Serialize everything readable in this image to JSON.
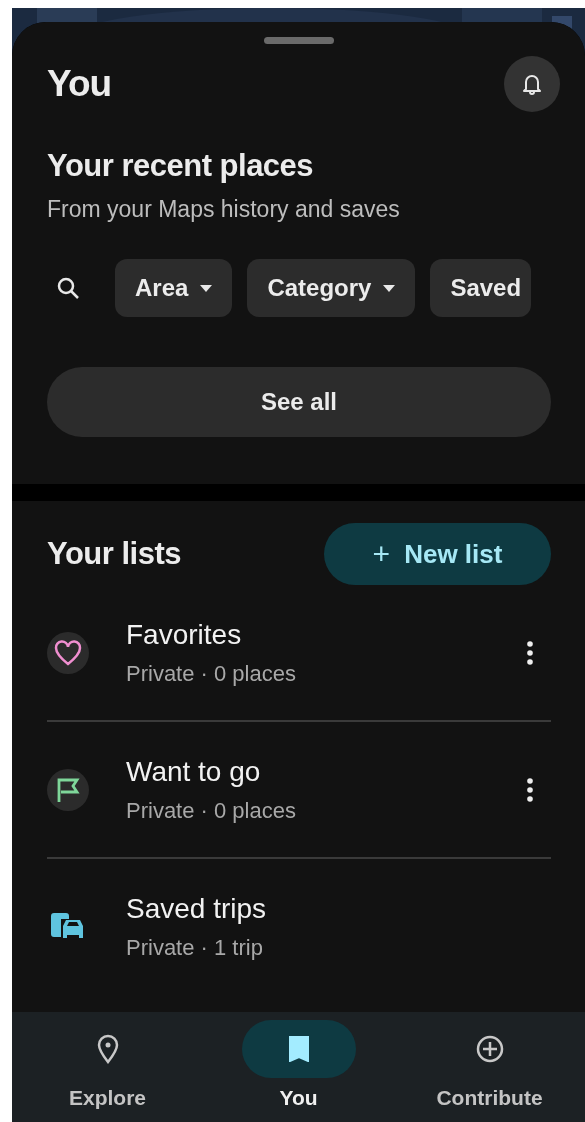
{
  "header": {
    "title": "You"
  },
  "recent": {
    "title": "Your recent places",
    "subtitle": "From your Maps history and saves",
    "filters": [
      {
        "label": "Area",
        "kind": "dropdown"
      },
      {
        "label": "Category",
        "kind": "dropdown"
      },
      {
        "label": "Saved",
        "kind": "plain"
      }
    ],
    "see_all": "See all"
  },
  "lists": {
    "title": "Your lists",
    "new_button": "New list",
    "new_icon": "+",
    "items": [
      {
        "name": "Favorites",
        "meta": "Private · 0 places",
        "kind": "heart",
        "color": "#f08fd0",
        "menu": true
      },
      {
        "name": "Want to go",
        "meta": "Private · 0 places",
        "kind": "flag",
        "color": "#7fd79a",
        "menu": true
      },
      {
        "name": "Saved trips",
        "meta": "Private · 1 trip",
        "kind": "trip",
        "color": "#5fc4df",
        "menu": false
      }
    ]
  },
  "nav": [
    {
      "label": "Explore",
      "kind": "pin",
      "selected": false
    },
    {
      "label": "You",
      "kind": "bookmark",
      "selected": true
    },
    {
      "label": "Contribute",
      "kind": "plus",
      "selected": false
    }
  ]
}
